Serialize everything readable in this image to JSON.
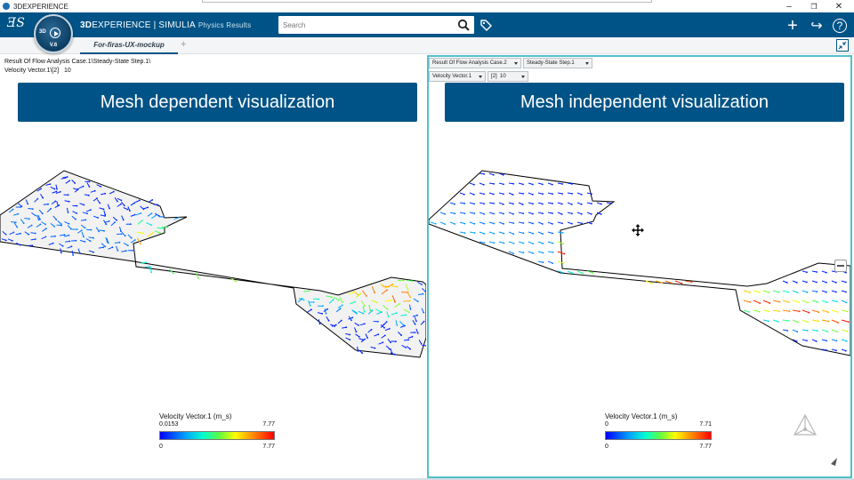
{
  "window": {
    "title": "3DEXPERIENCE",
    "minimize_glyph": "–",
    "maximize_glyph": "❐",
    "close_glyph": "✕"
  },
  "appbar": {
    "brand_bold": "3D",
    "brand_rest": "EXPERIENCE | SIMULIA",
    "brand_sub": "Physics Results",
    "search_placeholder": "Search",
    "plus_glyph": "+",
    "share_glyph": "↪",
    "help_glyph": "?"
  },
  "compass": {
    "north_label": "3D",
    "version": "V.6"
  },
  "tabs": [
    {
      "label": "For-firas-UX-mockup"
    }
  ],
  "tab_add_glyph": "+",
  "left_pane": {
    "result_path_line1": "Result Of Flow Analysis Case.1\\Steady-State Step.1\\",
    "result_path_line2_label": "Velocity Vector.1\\[2]",
    "result_path_line2_value": "10",
    "banner": "Mesh dependent visualization",
    "legend": {
      "title": "Velocity Vector.1 (m_s)",
      "top_min": "0.0153",
      "top_max": "7.77",
      "bottom_min": "0",
      "bottom_max": "7.77"
    }
  },
  "right_pane": {
    "selectors": {
      "case": "Result Of Flow Analysis Case.2",
      "step": "Steady-State Step.1",
      "vector": "Velocity Vector.1",
      "component": "[2]",
      "frame": "10"
    },
    "banner": "Mesh independent visualization",
    "legend": {
      "title": "Velocity Vector.1 (m_s)",
      "top_min": "0",
      "top_max": "7.71",
      "bottom_min": "0",
      "bottom_max": "7.77"
    }
  },
  "colors": {
    "brand_blue": "#005386",
    "active_pane_border": "#53bfcc"
  },
  "icons": {
    "search": "magnifier-icon",
    "tag": "tag-icon",
    "move_cursor": "move-cursor-icon",
    "triad": "axis-triad-icon"
  }
}
